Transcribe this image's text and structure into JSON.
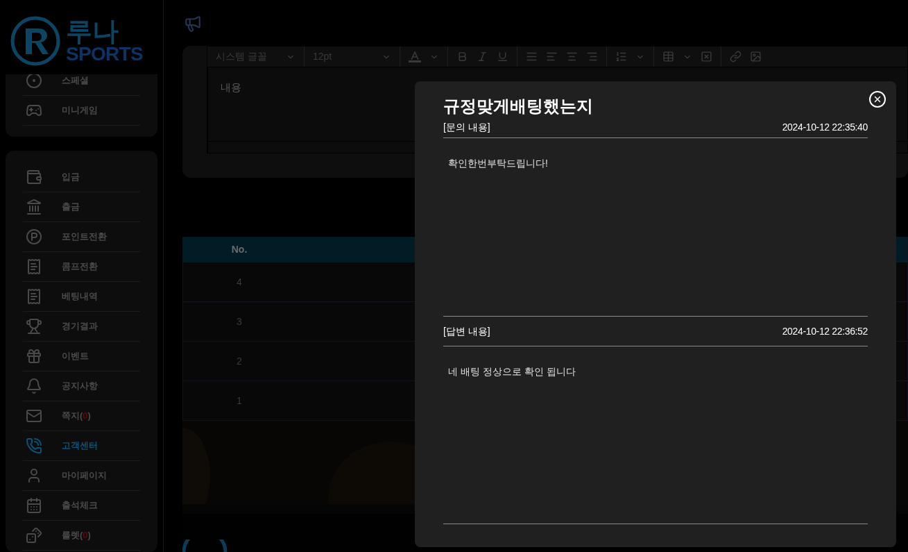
{
  "logo": {
    "name": "루나",
    "sub": "SPORTS"
  },
  "sidebar": {
    "groups": [
      {
        "items": [
          {
            "label": "스페셜",
            "selected": false
          },
          {
            "label": "미니게임",
            "selected": false
          }
        ]
      },
      {
        "items": [
          {
            "label": "입금",
            "selected": false
          },
          {
            "label": "출금",
            "selected": false
          },
          {
            "label": "포인트전환",
            "selected": false
          },
          {
            "label": "콤프전환",
            "selected": false
          },
          {
            "label": "베팅내역",
            "selected": false
          },
          {
            "label": "경기결과",
            "selected": false
          },
          {
            "label": "이벤트",
            "selected": false
          },
          {
            "label": "공지사항",
            "selected": false
          },
          {
            "label": "쪽지(",
            "count": "0",
            "label_end": ")",
            "selected": false
          },
          {
            "label": "고객센터",
            "selected": true
          },
          {
            "label": "마이페이지",
            "selected": false
          },
          {
            "label": "출석체크",
            "selected": false
          },
          {
            "label": "룰렛(",
            "count": "0",
            "label_end": ")",
            "selected": false
          }
        ]
      }
    ]
  },
  "editor": {
    "font": "시스템 글꼴",
    "size": "12pt",
    "placeholder": "내용"
  },
  "table": {
    "columns": [
      "No."
    ],
    "rows": [
      "4",
      "3",
      "2",
      "1"
    ]
  },
  "modal": {
    "title": "규정맞게배팅했는지",
    "sections": [
      {
        "label": "[문의 내용]",
        "date": "2024-10-12 22:35:40",
        "body": "확인한번부탁드립니다!"
      },
      {
        "label": "[답변 내용]",
        "date": "2024-10-12 22:36:52",
        "body": "네 배팅 정상으로 확인 됩니다"
      }
    ]
  }
}
